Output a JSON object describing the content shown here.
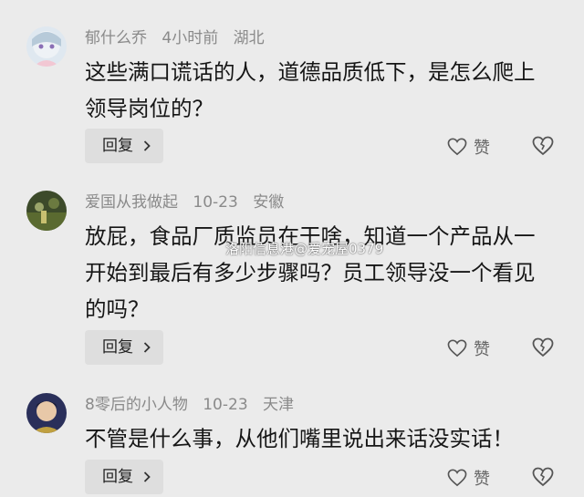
{
  "comments": [
    {
      "username": "郁什么乔",
      "time": "4小时前",
      "location": "湖北",
      "text": "这些满口谎话的人，道德品质低下，是怎么爬上领导岗位的？",
      "reply_label": "回复",
      "like_label": "赞"
    },
    {
      "username": "爱国从我做起",
      "time": "10-23",
      "location": "安徽",
      "text": "放屁，食品厂质监员在干啥，知道一个产品从一开始到最后有多少步骤吗？员工领导没一个看见的吗？",
      "reply_label": "回复",
      "like_label": "赞"
    },
    {
      "username": "8零后的小人物",
      "time": "10-23",
      "location": "天津",
      "text": "不管是什么事，从他们嘴里说出来话没实话！",
      "reply_label": "回复",
      "like_label": "赞"
    }
  ],
  "watermark": "洛阳信息港@爱宠屋0379",
  "colors": {
    "background": "#ebebeb",
    "meta": "#8a8a8a",
    "text": "#161616",
    "reply_bg": "#dedede"
  },
  "icons": {
    "like": "heart-outline-icon",
    "dislike": "broken-heart-icon",
    "reply_chevron": "chevron-right-icon"
  }
}
